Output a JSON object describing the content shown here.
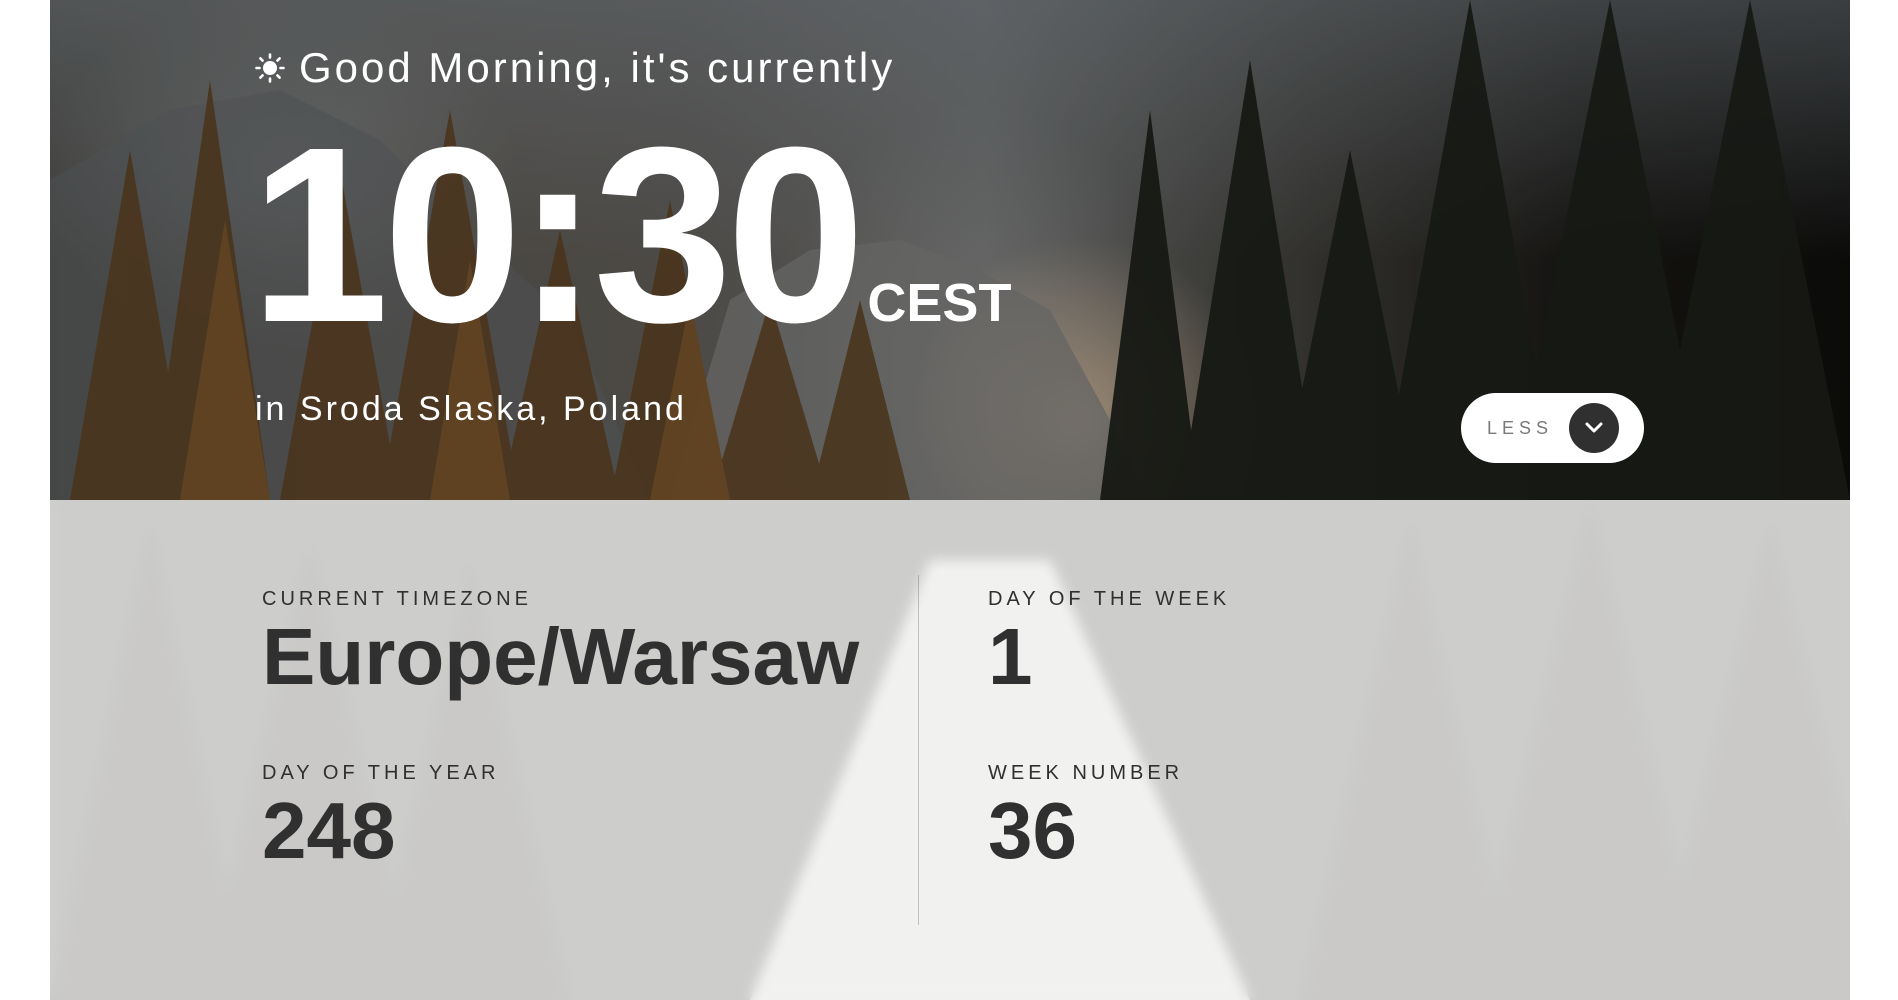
{
  "hero": {
    "greeting": "Good Morning, it's currently",
    "greeting_icon": "sun-icon",
    "time": "10:30",
    "timezone_abbr": "CEST",
    "location": "in Sroda Slaska, Poland"
  },
  "toggle": {
    "label": "LESS",
    "icon": "chevron-down-icon"
  },
  "details": {
    "timezone": {
      "label": "CURRENT TIMEZONE",
      "value": "Europe/Warsaw"
    },
    "day_of_week": {
      "label": "DAY OF THE WEEK",
      "value": "1"
    },
    "day_of_year": {
      "label": "DAY OF THE YEAR",
      "value": "248"
    },
    "week_number": {
      "label": "WEEK NUMBER",
      "value": "36"
    }
  },
  "colors": {
    "text_light": "#ffffff",
    "text_dark": "#303030",
    "button_circle": "#303030",
    "panel_overlay": "#ffffffbf"
  }
}
